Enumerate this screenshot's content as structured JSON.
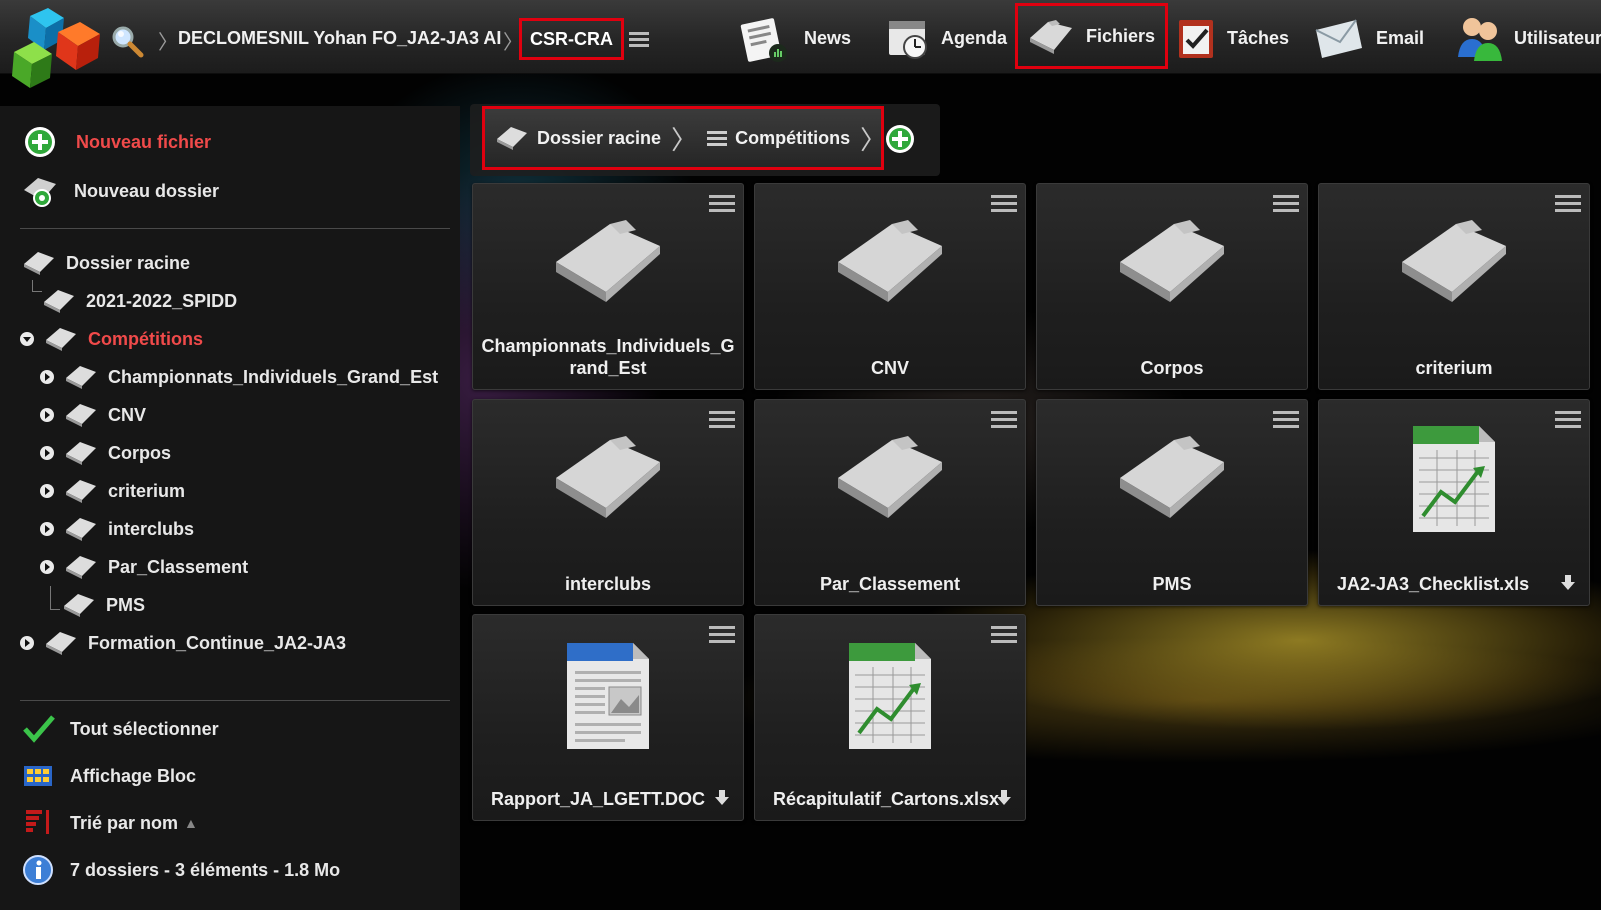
{
  "topbar": {
    "user": "DECLOMESNIL Yohan FO_JA2-JA3 AI",
    "org": "CSR-CRA",
    "nav": [
      {
        "label": "News",
        "icon": "news-icon"
      },
      {
        "label": "Agenda",
        "icon": "agenda-icon"
      },
      {
        "label": "Fichiers",
        "icon": "folder-icon",
        "active": true
      },
      {
        "label": "Tâches",
        "icon": "tasks-icon"
      },
      {
        "label": "Email",
        "icon": "email-icon"
      },
      {
        "label": "Utilisateur",
        "icon": "users-icon"
      }
    ]
  },
  "sidebar": {
    "new_file": "Nouveau fichier",
    "new_folder": "Nouveau dossier",
    "tree": {
      "root": "Dossier racine",
      "items": [
        "2021-2022_SPIDD",
        "Compétitions",
        "Championnats_Individuels_Grand_Est",
        "CNV",
        "Corpos",
        "criterium",
        "interclubs",
        "Par_Classement",
        "PMS",
        "Formation_Continue_JA2-JA3"
      ]
    },
    "select_all": "Tout sélectionner",
    "display_mode": "Affichage Bloc",
    "sort": "Trié par nom",
    "sort_arrow": "▲",
    "summary": "7 dossiers - 3 éléments - 1.8 Mo"
  },
  "breadcrumb": {
    "root": "Dossier racine",
    "current": "Compétitions"
  },
  "tiles": [
    {
      "label": "Championnats_Individuels_Grand_Est",
      "type": "folder"
    },
    {
      "label": "CNV",
      "type": "folder"
    },
    {
      "label": "Corpos",
      "type": "folder"
    },
    {
      "label": "criterium",
      "type": "folder"
    },
    {
      "label": "interclubs",
      "type": "folder"
    },
    {
      "label": "Par_Classement",
      "type": "folder"
    },
    {
      "label": "PMS",
      "type": "folder"
    },
    {
      "label": "JA2-JA3_Checklist.xls",
      "type": "excel"
    },
    {
      "label": "Rapport_JA_LGETT.DOC",
      "type": "word"
    },
    {
      "label": "Récapitulatif_Cartons.xlsx",
      "type": "excel"
    }
  ],
  "colors": {
    "highlight": "#e0000f",
    "active_text": "#f04a4a",
    "accent_green": "#2fa83a"
  }
}
